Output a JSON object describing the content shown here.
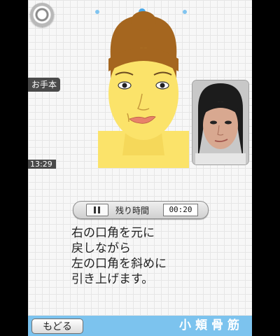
{
  "nav": {
    "page_dots": 3,
    "active_dot": 1
  },
  "sidebar": {
    "model_tab": "お手本",
    "clock": "13:29"
  },
  "timer": {
    "label": "残り時間",
    "value": "00:20",
    "state_icon": "pause-icon"
  },
  "instruction": {
    "lines": [
      "右の口角を元に",
      "戻しながら",
      "左の口角を斜めに",
      "引き上げます。"
    ]
  },
  "footer": {
    "back_label": "もどる",
    "section_title": "小頬骨筋"
  },
  "colors": {
    "accent": "#7cc3ee",
    "skin": "#fbe36a",
    "hair": "#a5661f",
    "background": "#f7f7f7"
  }
}
